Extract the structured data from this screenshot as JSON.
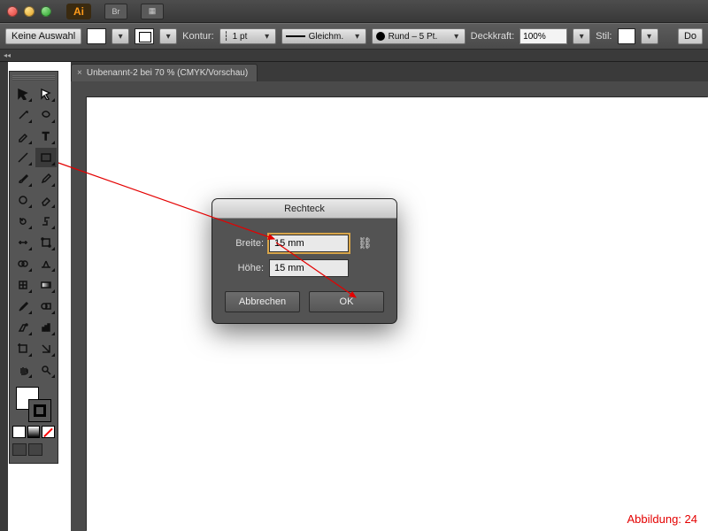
{
  "titlebar": {
    "app_abbr": "Ai",
    "btn_br": "Br",
    "btn_layout": "▦"
  },
  "controlbar": {
    "selection_label": "Keine Auswahl",
    "stroke_label": "Kontur:",
    "stroke_weight": "1 pt",
    "profile_label": "Gleichm.",
    "brush_label": "Rund – 5 Pt.",
    "opacity_label": "Deckkraft:",
    "opacity_value": "100%",
    "style_label": "Stil:",
    "doc_setup": "Do"
  },
  "tab": {
    "close": "×",
    "title": "Unbenannt-2 bei 70 % (CMYK/Vorschau)"
  },
  "dialog": {
    "title": "Rechteck",
    "width_label": "Breite:",
    "width_value": "15 mm",
    "height_label": "Höhe:",
    "height_value": "15 mm",
    "cancel": "Abbrechen",
    "ok": "OK"
  },
  "caption": "Abbildung: 24",
  "tools": [
    "selection",
    "direct-selection",
    "magic-wand",
    "lasso",
    "pen",
    "type",
    "line-segment",
    "rectangle",
    "paintbrush",
    "pencil",
    "blob-brush",
    "eraser",
    "rotate",
    "scale",
    "width",
    "free-transform",
    "shape-builder",
    "perspective-grid",
    "mesh",
    "gradient",
    "eyedropper",
    "blend",
    "symbol-sprayer",
    "column-graph",
    "artboard",
    "slice",
    "hand",
    "zoom"
  ]
}
